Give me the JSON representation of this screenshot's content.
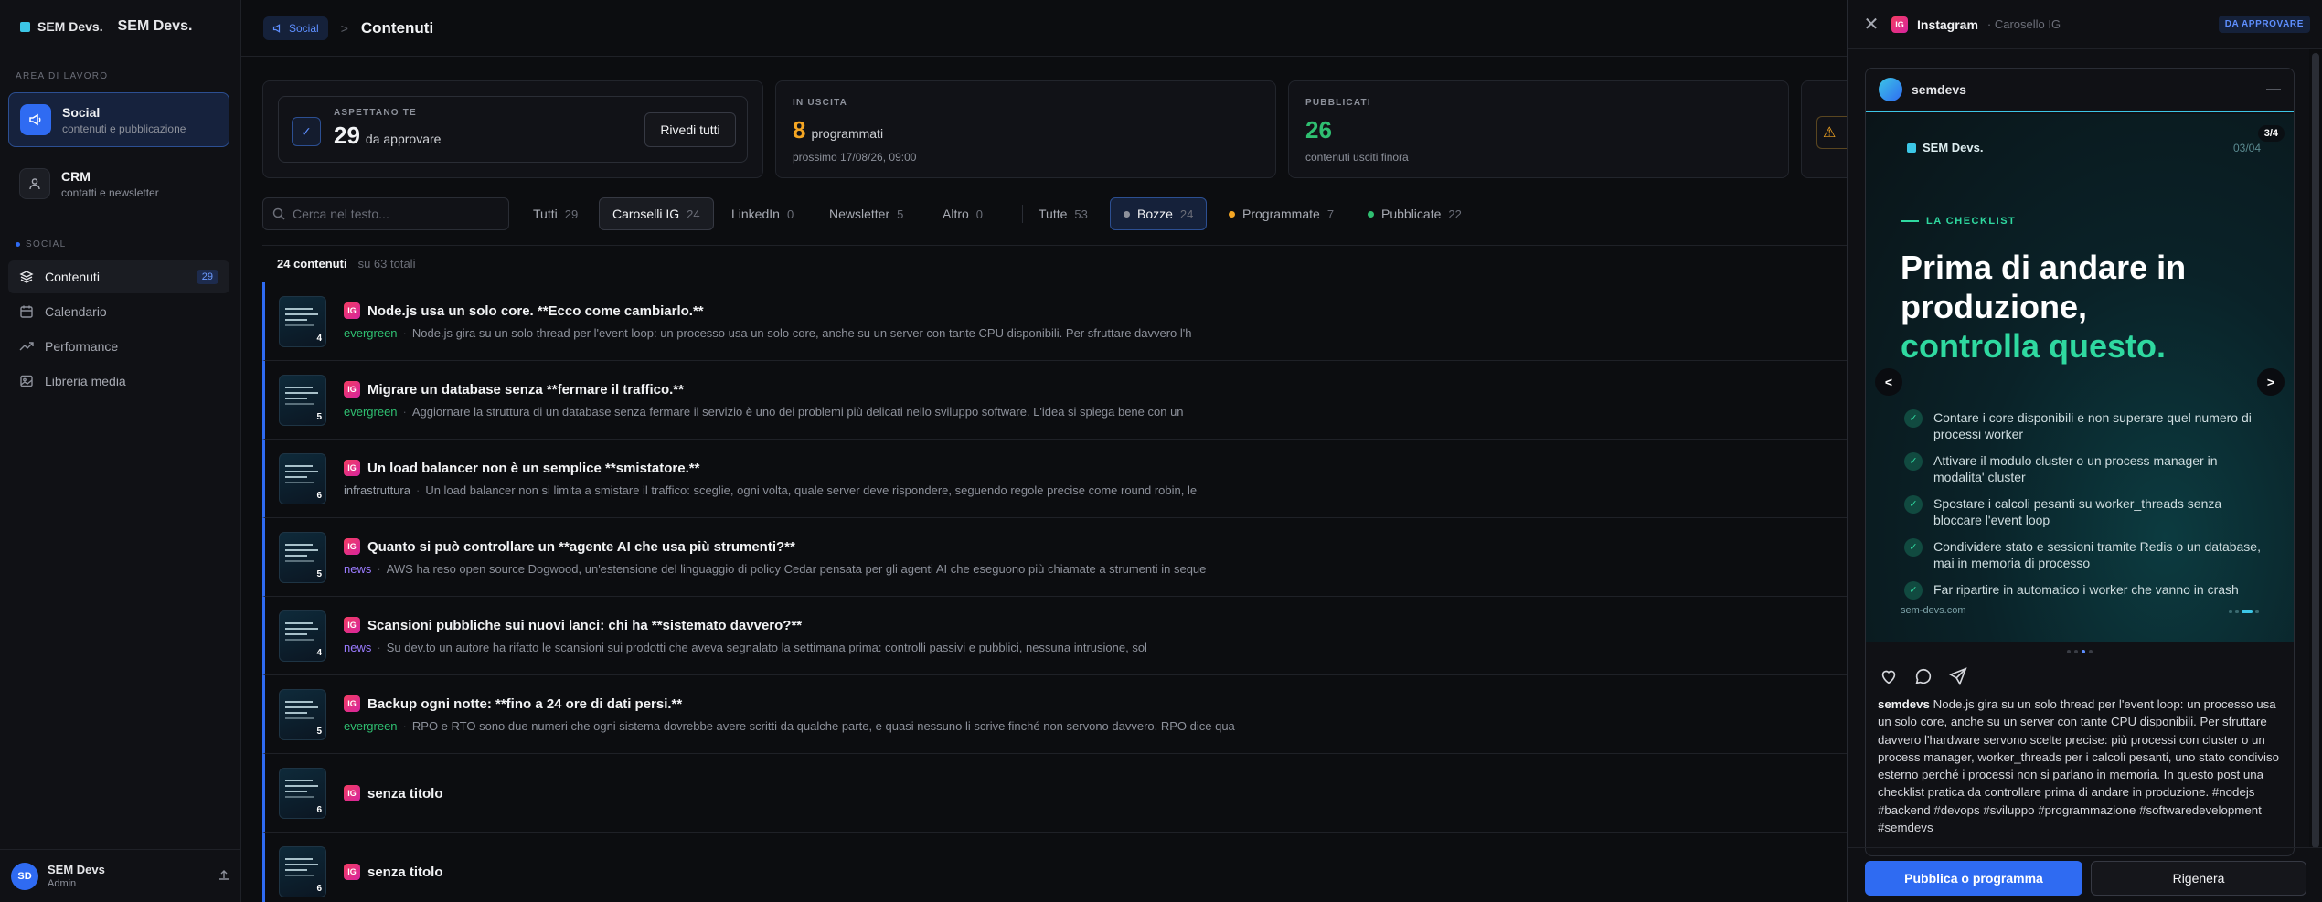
{
  "sidebar": {
    "brand_small": "SEM Devs.",
    "brand_large": "SEM Devs.",
    "workspace_label": "AREA DI LAVORO",
    "workspaces": [
      {
        "title": "Social",
        "subtitle": "contenuti e pubblicazione",
        "icon": "megaphone-icon"
      },
      {
        "title": "CRM",
        "subtitle": "contatti e newsletter",
        "icon": "person-icon"
      }
    ],
    "section_label": "SOCIAL",
    "nav": [
      {
        "label": "Contenuti",
        "icon": "layers-icon",
        "badge": "29"
      },
      {
        "label": "Calendario",
        "icon": "calendar-icon"
      },
      {
        "label": "Performance",
        "icon": "trend-icon"
      },
      {
        "label": "Libreria media",
        "icon": "image-icon"
      }
    ],
    "user": {
      "initials": "SD",
      "name": "SEM Devs",
      "role": "Admin"
    }
  },
  "topbar": {
    "crumb": "Social",
    "separator": ">",
    "title": "Contenuti"
  },
  "stats": {
    "waiting": {
      "label": "ASPETTANO TE",
      "value": "29",
      "unit": "da approvare",
      "button": "Rivedi tutti"
    },
    "outgoing": {
      "label": "IN USCITA",
      "value": "8",
      "unit": "programmati",
      "note": "prossimo 17/08/26, 09:00"
    },
    "published": {
      "label": "PUBBLICATI",
      "value": "26",
      "note": "contenuti usciti finora"
    }
  },
  "filters": {
    "search_placeholder": "Cerca nel testo...",
    "types": [
      {
        "label": "Tutti",
        "count": "29"
      },
      {
        "label": "Caroselli IG",
        "count": "24"
      },
      {
        "label": "LinkedIn",
        "count": "0"
      },
      {
        "label": "Newsletter",
        "count": "5"
      },
      {
        "label": "Altro",
        "count": "0"
      }
    ],
    "states": [
      {
        "label": "Tutte",
        "count": "53"
      },
      {
        "label": "Bozze",
        "count": "24",
        "color": "#8d919b"
      },
      {
        "label": "Programmate",
        "count": "7",
        "color": "#f5a623"
      },
      {
        "label": "Pubblicate",
        "count": "22",
        "color": "#2fbf71"
      }
    ]
  },
  "list": {
    "count_label": "24 contenuti",
    "total_label": "su 63 totali",
    "rows": [
      {
        "title": "Node.js usa un solo core. **Ecco come cambiarlo.**",
        "tag": "evergreen",
        "snippet": "Node.js gira su un solo thread per l'event loop: un processo usa un solo core, anche su un server con tante CPU disponibili. Per sfruttare davvero l'h",
        "slides": "4"
      },
      {
        "title": "Migrare un database senza **fermare il traffico.**",
        "tag": "evergreen",
        "snippet": "Aggiornare la struttura di un database senza fermare il servizio è uno dei problemi più delicati nello sviluppo software. L'idea si spiega bene con un",
        "slides": "5"
      },
      {
        "title": "Un load balancer non è un semplice **smistatore.**",
        "tag": "infrastruttura",
        "snippet": "Un load balancer non si limita a smistare il traffico: sceglie, ogni volta, quale server deve rispondere, seguendo regole precise come round robin, le",
        "slides": "6"
      },
      {
        "title": "Quanto si può controllare un **agente AI che usa più strumenti?**",
        "tag": "news",
        "snippet": "AWS ha reso open source Dogwood, un'estensione del linguaggio di policy Cedar pensata per gli agenti AI che eseguono più chiamate a strumenti in seque",
        "slides": "5"
      },
      {
        "title": "Scansioni pubbliche sui nuovi lanci: chi ha **sistemato davvero?**",
        "tag": "news",
        "snippet": "Su dev.to un autore ha rifatto le scansioni sui prodotti che aveva segnalato la settimana prima: controlli passivi e pubblici, nessuna intrusione, sol",
        "slides": "4"
      },
      {
        "title": "Backup ogni notte: **fino a 24 ore di dati persi.**",
        "tag": "evergreen",
        "snippet": "RPO e RTO sono due numeri che ogni sistema dovrebbe avere scritti da qualche parte, e quasi nessuno li scrive finché non servono davvero. RPO dice qua",
        "slides": "5"
      },
      {
        "title": "senza titolo",
        "tag": "",
        "snippet": "",
        "slides": "6"
      },
      {
        "title": "senza titolo",
        "tag": "",
        "snippet": "",
        "slides": "6"
      }
    ]
  },
  "panel": {
    "title": "Instagram",
    "subtitle": "· Carosello IG",
    "badge": "DA APPROVARE",
    "account": "semdevs",
    "slide": {
      "brand": "SEM Devs.",
      "index": "03/04",
      "counter": "3/4",
      "kicker": "LA CHECKLIST",
      "heading_1": "Prima di andare in",
      "heading_2": "produzione,",
      "heading_accent": "controlla questo.",
      "items": [
        "Contare i core disponibili e non superare quel numero di processi worker",
        "Attivare il modulo cluster o un process manager in modalita' cluster",
        "Spostare i calcoli pesanti su worker_threads senza bloccare l'event loop",
        "Condividere stato e sessioni tramite Redis o un database, mai in memoria di processo",
        "Far ripartire in automatico i worker che vanno in crash"
      ],
      "url": "sem-devs.com",
      "prev": "<",
      "next": ">"
    },
    "caption_user": "semdevs",
    "caption_text": "Node.js gira su un solo thread per l'event loop: un processo usa un solo core, anche su un server con tante CPU disponibili. Per sfruttare davvero l'hardware servono scelte precise: più processi con cluster o un process manager, worker_threads per i calcoli pesanti, uno stato condiviso esterno perché i processi non si parlano in memoria. In questo post una checklist pratica da controllare prima di andare in produzione. #nodejs #backend #devops #sviluppo #programmazione #softwaredevelopment #semdevs",
    "publish_button": "Pubblica o programma",
    "regen_button": "Rigenera"
  }
}
